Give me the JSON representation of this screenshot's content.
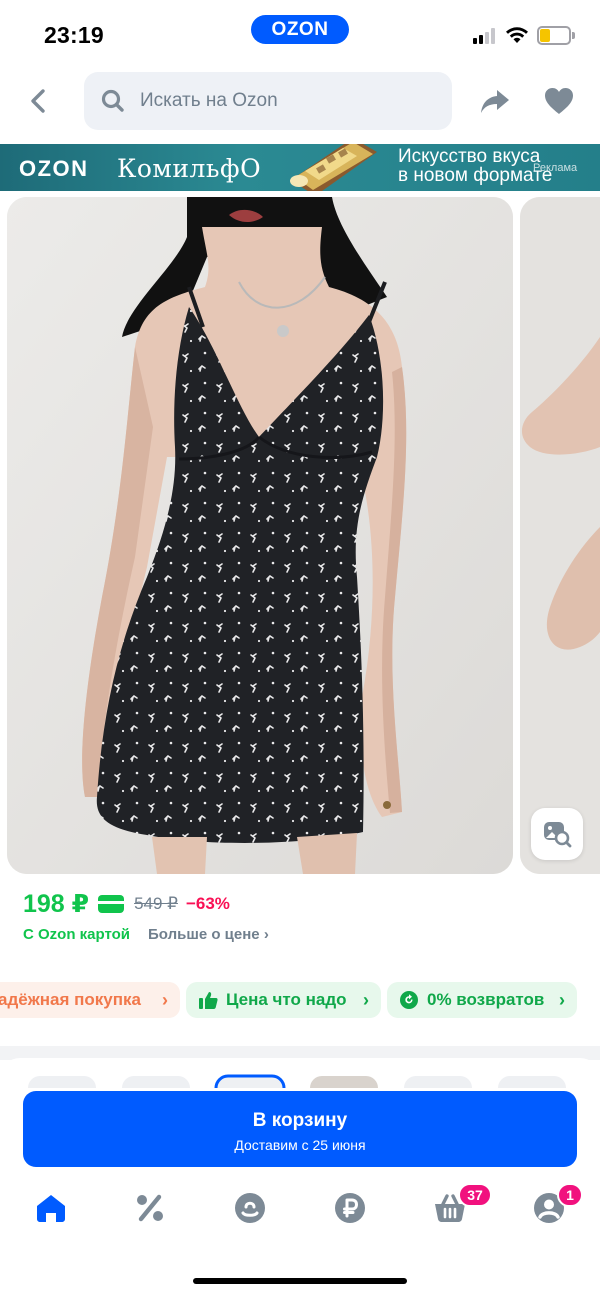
{
  "status_bar": {
    "time": "23:19",
    "logo": "OZON",
    "battery_level": 0.35
  },
  "header": {
    "search_placeholder": "Искать на Ozon",
    "icons": {
      "back": "chevron-left-icon",
      "search": "search-icon",
      "share": "share-icon",
      "favorite": "heart-icon"
    }
  },
  "banner": {
    "ozon": "OZON",
    "brand": "КомильфО",
    "tagline_line1": "Искусство вкуса",
    "tagline_line2": "в новом формате",
    "ad_label": "Реклама"
  },
  "gallery": {
    "visual_search_icon": "image-search-icon"
  },
  "price": {
    "current": "198 ₽",
    "old": "549 ₽",
    "discount": "−63%",
    "with_card": "С Ozon картой",
    "more_about_price": "Больше о цене",
    "more_chevron": "›"
  },
  "chips": [
    {
      "label": "адёжная покупка",
      "chevron": "›",
      "icon": ""
    },
    {
      "label": "Цена что надо",
      "chevron": "›",
      "icon": "thumbs-up-icon"
    },
    {
      "label": "0% возвратов",
      "chevron": "›",
      "icon": "return-icon"
    }
  ],
  "cart": {
    "label": "В корзину",
    "delivery": "Доставим с 25 июня"
  },
  "tab_bar": {
    "tabs": [
      {
        "icon": "home-icon",
        "active": true
      },
      {
        "icon": "percent-icon",
        "active": false
      },
      {
        "icon": "fresh-icon",
        "active": false
      },
      {
        "icon": "ruble-icon",
        "active": false
      },
      {
        "icon": "cart-icon",
        "active": false,
        "badge": "37"
      },
      {
        "icon": "profile-icon",
        "active": false,
        "badge": "1"
      }
    ]
  },
  "colors": {
    "brand_blue": "#005bff",
    "price_green": "#10c44c",
    "discount_pink": "#f91155",
    "badge_pink": "#f1117e"
  }
}
